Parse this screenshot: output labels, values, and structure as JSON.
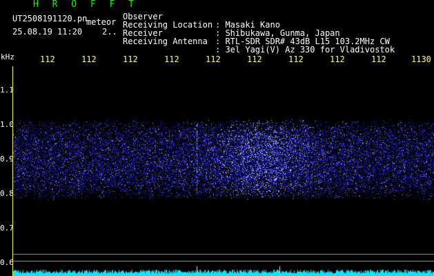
{
  "header": {
    "title": "H R O F F T",
    "filename": "UT2508191120.pn",
    "kind": "meteor",
    "datetime": "25.08.19 11:20    2..",
    "meta": [
      {
        "label": "Observer",
        "value": ": Masaki Kano"
      },
      {
        "label": "Receiving Location",
        "value": ": Shibukawa, Gunma, Japan"
      },
      {
        "label": "Receiver",
        "value": ": RTL-SDR SDR# 43dB L15 103.2MHz CW"
      },
      {
        "label": "Receiving Antenna",
        "value": ": 3el Yagi(V) Az 330 for Vladivostok"
      }
    ]
  },
  "time_axis": {
    "ticks": [
      "112",
      "112",
      "112",
      "112",
      "112",
      "112",
      "112",
      "112",
      "112",
      "1130"
    ]
  },
  "freq_axis": {
    "unit": "kHz",
    "labels": [
      "1.1",
      "1.0",
      "0.9",
      "0.8",
      "0.7",
      "0.6"
    ]
  },
  "colors": {
    "noise": "#2a2aff",
    "bright": "#8fb8ff",
    "bottom_band": "#00ffff",
    "tick": "#ffff66"
  }
}
